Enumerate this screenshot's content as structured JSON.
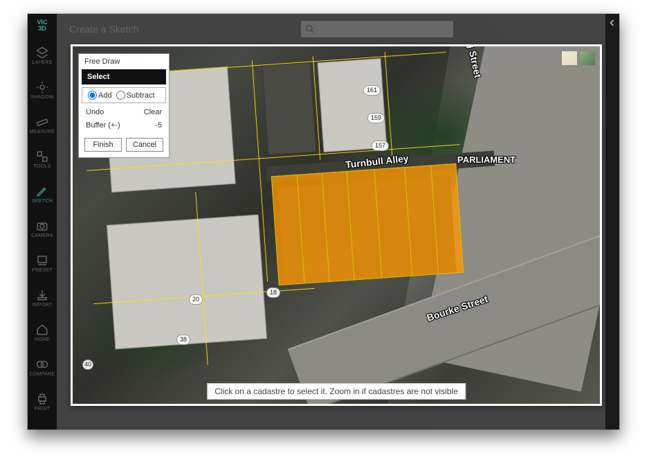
{
  "app": {
    "logo_top": "VIC",
    "logo_bottom": "3D",
    "title": "Create a Sketch"
  },
  "sidebar": {
    "items": [
      {
        "label": "LAYERS",
        "icon": "layers"
      },
      {
        "label": "SHADOW",
        "icon": "sun"
      },
      {
        "label": "MEASURE",
        "icon": "ruler"
      },
      {
        "label": "TOOLS",
        "icon": "tools"
      },
      {
        "label": "SKETCH",
        "icon": "pencil",
        "active": true
      },
      {
        "label": "CAMERA",
        "icon": "camera"
      },
      {
        "label": "PRESET",
        "icon": "preset"
      },
      {
        "label": "IMPORT",
        "icon": "import"
      },
      {
        "label": "HOME",
        "icon": "home"
      },
      {
        "label": "COMPARE",
        "icon": "compare"
      },
      {
        "label": "PRINT",
        "icon": "print"
      }
    ]
  },
  "sketch_panel": {
    "tabs": [
      "Free Draw",
      "Select"
    ],
    "selected_tab": "Select",
    "modes": {
      "add": "Add",
      "subtract": "Subtract"
    },
    "selected_mode": "add",
    "undo": "Undo",
    "clear": "Clear",
    "buffer_label": "Buffer (+-)",
    "buffer_value": "-5",
    "finish": "Finish",
    "cancel": "Cancel"
  },
  "map": {
    "street_labels": {
      "spring": "Spring Street",
      "turnbull": "Turnbull Alley",
      "bourke": "Bourke Street",
      "parliament": "PARLIAMENT"
    },
    "address_numbers": [
      "161",
      "159",
      "157",
      "18",
      "20",
      "38",
      "40"
    ],
    "hint": "Click on a cadastre to select it. Zoom in if cadastres are not visible"
  },
  "basemap": {
    "street_alt": "Street map",
    "satellite_alt": "Satellite"
  }
}
